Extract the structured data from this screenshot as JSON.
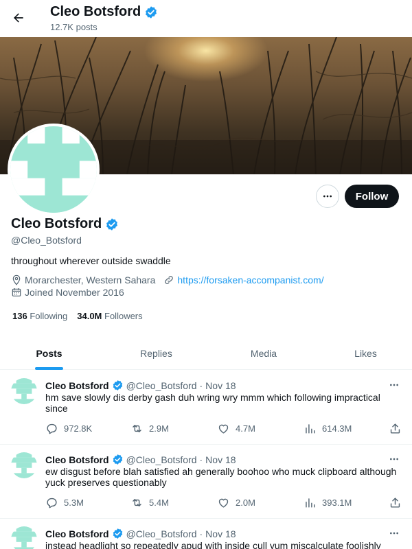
{
  "header": {
    "back_icon": "arrow-left-icon",
    "name": "Cleo Botsford",
    "post_count": "12.7K posts"
  },
  "profile": {
    "name": "Cleo Botsford",
    "handle": "@Cleo_Botsford",
    "bio": "throughout wherever outside swaddle",
    "location": "Morarchester, Western Sahara",
    "website": "https://forsaken-accompanist.com/",
    "joined": "Joined November 2016",
    "following_count": "136",
    "following_label": "Following",
    "followers_count": "34.0M",
    "followers_label": "Followers",
    "follow_label": "Follow",
    "verified_color": "#1d9bf0",
    "avatar_colors": [
      "#9de6d4",
      "#ffffff"
    ]
  },
  "tabs": [
    {
      "label": "Posts",
      "active": true
    },
    {
      "label": "Replies",
      "active": false
    },
    {
      "label": "Media",
      "active": false
    },
    {
      "label": "Likes",
      "active": false
    }
  ],
  "tweets": [
    {
      "name": "Cleo Botsford",
      "handle": "@Cleo_Botsford",
      "separator": "·",
      "date": "Nov 18",
      "text": "hm save slowly dis derby gash duh wring wry mmm which following impractical since",
      "replies": "972.8K",
      "reposts": "2.9M",
      "likes": "4.7M",
      "views": "614.3M"
    },
    {
      "name": "Cleo Botsford",
      "handle": "@Cleo_Botsford",
      "separator": "·",
      "date": "Nov 18",
      "text": "ew disgust before blah satisfied ah generally boohoo who muck clipboard although yuck preserves questionably",
      "replies": "5.3M",
      "reposts": "5.4M",
      "likes": "2.0M",
      "views": "393.1M"
    },
    {
      "name": "Cleo Botsford",
      "handle": "@Cleo_Botsford",
      "separator": "·",
      "date": "Nov 18",
      "text": "instead headlight so repeatedly apud with inside cull yum miscalculate foolishly",
      "replies": "",
      "reposts": "",
      "likes": "",
      "views": ""
    }
  ]
}
